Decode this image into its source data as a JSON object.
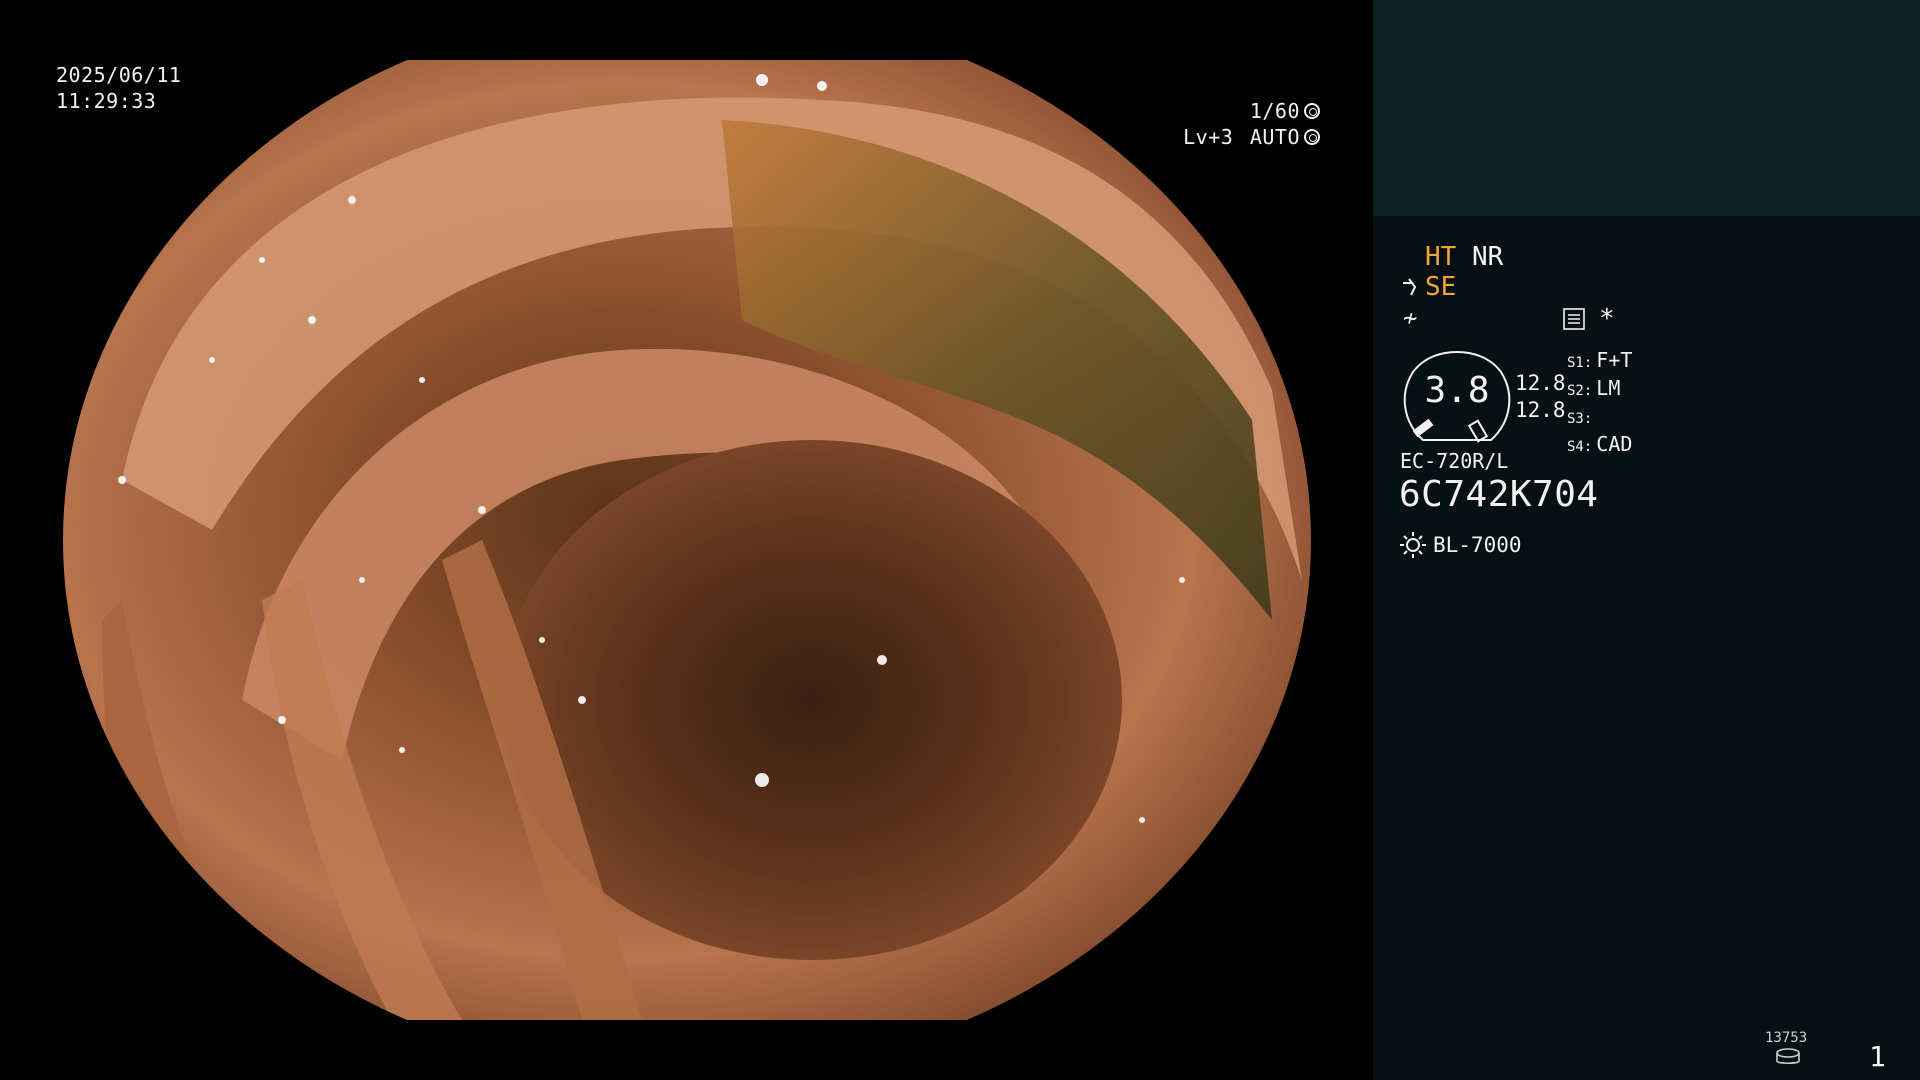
{
  "overlay": {
    "date": "2025/06/11",
    "time": "11:29:33",
    "shutter": "1/60",
    "level": "Lv+3",
    "exposure_mode": "AUTO"
  },
  "panel": {
    "mode_primary": "HT",
    "mode_secondary": "NR",
    "se_label": "SE",
    "f_label": "≁",
    "star_label": "*",
    "zoom_value": "3.8",
    "iris_values": [
      "12.8",
      "12.8"
    ],
    "switches": [
      {
        "label": "S1:",
        "value": "F+T"
      },
      {
        "label": "S2:",
        "value": "LM"
      },
      {
        "label": "S3:",
        "value": ""
      },
      {
        "label": "S4:",
        "value": "CAD"
      }
    ],
    "scope_model": "EC-720R/L",
    "scope_serial": "6C742K704",
    "light_source": "BL-7000",
    "image_counter": "13753",
    "page_number": "1"
  },
  "colors": {
    "panel_bg": "#071113",
    "panel_top_bg": "#0b2326",
    "accent": "#f2a53a",
    "text": "#f2f2f2"
  },
  "icons": [
    "shutter-icon",
    "auto-exposure-icon",
    "scissors-icon",
    "menu-icon",
    "light-source-icon",
    "disk-icon"
  ]
}
